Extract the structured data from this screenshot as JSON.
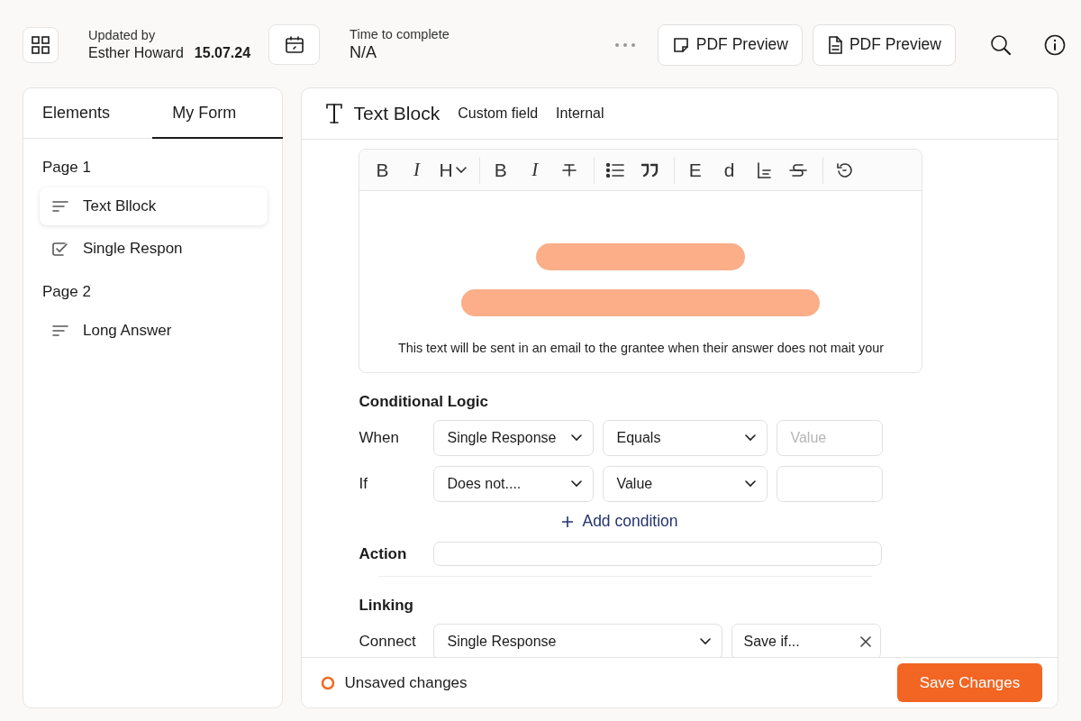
{
  "header": {
    "updated_label": "Updated by",
    "updated_name": "Esther Howard",
    "updated_date": "15.07.24",
    "time_label": "Time to complete",
    "time_value": "N/A",
    "pdf_buttons": [
      {
        "kind": "note",
        "label": "PDF Preview"
      },
      {
        "kind": "document",
        "label": "PDF Preview"
      }
    ]
  },
  "sidebar": {
    "tabs": [
      {
        "label": "Elements",
        "selected": false
      },
      {
        "label": "My Form",
        "selected": true
      }
    ],
    "pages": [
      {
        "title": "Page 1",
        "items": [
          {
            "kind": "text",
            "label": "Text Bllock",
            "selected": true
          },
          {
            "kind": "check",
            "label": "Single Respon",
            "selected": false
          }
        ]
      },
      {
        "title": "Page 2",
        "items": [
          {
            "kind": "text",
            "label": "Long Answer",
            "selected": false
          }
        ]
      }
    ]
  },
  "editor_panel": {
    "title": "Text Block",
    "tags": [
      "Custom field",
      "Internal"
    ],
    "toolbar": [
      [
        {
          "kind": "glyph",
          "label": "B",
          "italic": false
        },
        {
          "kind": "glyph",
          "label": "I",
          "italic": true
        },
        {
          "kind": "glyph",
          "label": "H",
          "italic": false,
          "dropdown": true
        }
      ],
      [
        {
          "kind": "glyph",
          "label": "B",
          "italic": false
        },
        {
          "kind": "glyph",
          "label": "I",
          "italic": true
        },
        {
          "kind": "strikethrough"
        }
      ],
      [
        {
          "kind": "list"
        },
        {
          "kind": "quote"
        }
      ],
      [
        {
          "kind": "glyph",
          "label": "E",
          "italic": false
        },
        {
          "kind": "glyph",
          "label": "d",
          "italic": false
        },
        {
          "kind": "align"
        },
        {
          "kind": "strike"
        }
      ],
      [
        {
          "kind": "undo"
        }
      ]
    ],
    "caption": "This text will be sent in an email to the grantee when their answer does not mait your",
    "conditional": {
      "heading": "Conditional Logic",
      "rows": [
        {
          "label": "When",
          "fields": [
            {
              "kind": "select",
              "value": "Single Response"
            },
            {
              "kind": "select",
              "value": "Equals"
            },
            {
              "kind": "input",
              "placeholder": "Value"
            }
          ]
        },
        {
          "label": "If",
          "fields": [
            {
              "kind": "select",
              "value": "Does not...."
            },
            {
              "kind": "select",
              "value": "Value"
            },
            {
              "kind": "input"
            }
          ]
        }
      ],
      "add_condition": "Add condition",
      "action_label": "Action"
    },
    "linking": {
      "heading": "Linking",
      "rows": [
        {
          "label": "Connect",
          "fields": [
            {
              "kind": "select",
              "value": "Single Response"
            },
            {
              "kind": "clearable",
              "value": "Save if..."
            }
          ]
        }
      ]
    },
    "footer": {
      "status": "Unsaved changes",
      "save": "Save Changes"
    }
  }
}
